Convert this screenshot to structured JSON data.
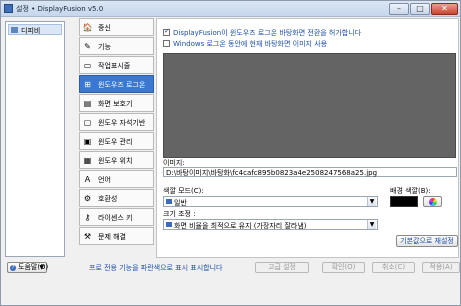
{
  "window": {
    "title": "설정 • DisplayFusion v5.0"
  },
  "left_panel": {
    "item_label": "디피비"
  },
  "nav": {
    "items": [
      {
        "label": "중신",
        "icon": "🏠"
      },
      {
        "label": "기능",
        "icon": "✎"
      },
      {
        "label": "작업표시줄",
        "icon": "▭"
      },
      {
        "label": "윈도우즈 로그온",
        "icon": "⊞"
      },
      {
        "label": "화면 보호기",
        "icon": "▤"
      },
      {
        "label": "윈도우 자석기반",
        "icon": "▢"
      },
      {
        "label": "윈도우 관리",
        "icon": "▣"
      },
      {
        "label": "윈도우 위치",
        "icon": "▦"
      },
      {
        "label": "언어",
        "icon": "Ａ"
      },
      {
        "label": "호환성",
        "icon": "⚙"
      },
      {
        "label": "라이센스 키",
        "icon": "⚷"
      },
      {
        "label": "문제 해결",
        "icon": "⚒"
      }
    ]
  },
  "content": {
    "enable_checkbox_label": "DisplayFusion이 윈도우즈 로그온 바탕화면 전환을 허가합니다",
    "windows_checkbox_label": "Windows 로그온 동안에 현재 바탕화면 이미지 사용",
    "image_label": "이미지:",
    "image_path": "D:\\바탕이미지\\바탕화\\fc4cafc895b0823a4e2508247568a25.jpg",
    "color_mode_label": "색깔 모드(C):",
    "color_mode_value": "일반",
    "bg_color_label": "배경 색깔(B):",
    "size_adjust_label": "크기 조정 :",
    "size_adjust_value": "화면 비율을 최적으로 유지 (가장자리 잘라냄)",
    "default_button": "기본값으로 재설정"
  },
  "bottom": {
    "help_label": "도움말(O)",
    "notice": "프로 전용 기능을 파란색으로 표시 표시합니다",
    "advanced_button": "고급 설정",
    "ok_button": "확인(O)",
    "cancel_button": "취소(C)",
    "apply_button": "적용(A)"
  },
  "colors": {
    "accent": "#1c4fa7",
    "nav_active": "#3b78d0",
    "preview_bg": "#646464",
    "bg_color_swatch": "#000000"
  }
}
